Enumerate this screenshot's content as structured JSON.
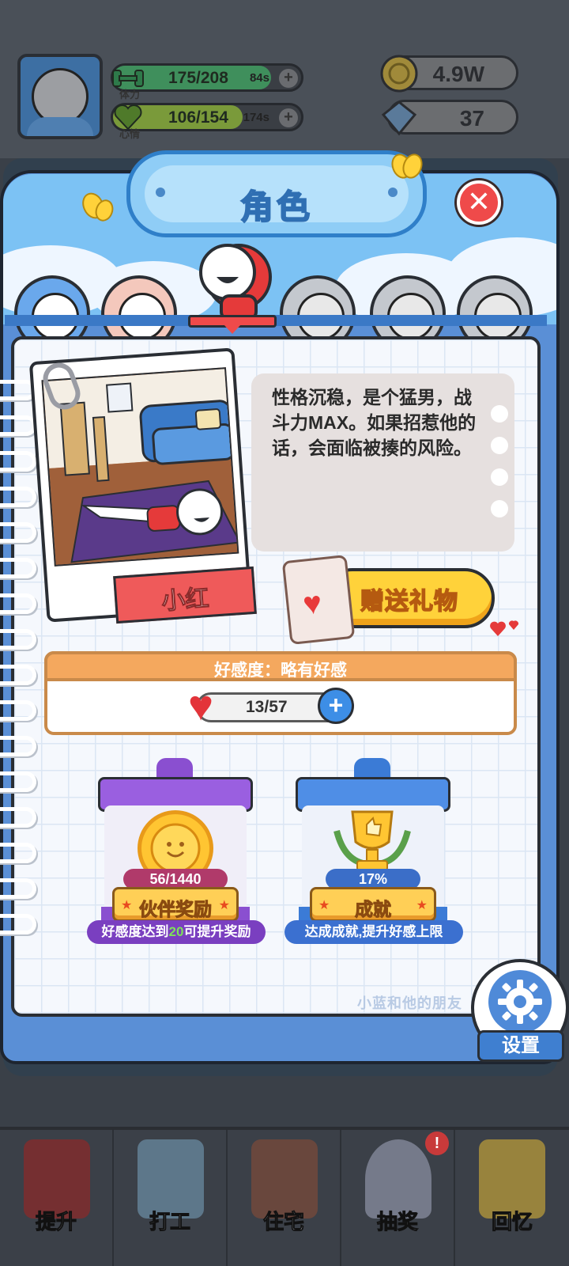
{
  "hud": {
    "stamina": {
      "label": "体力",
      "value": "175/208",
      "timer": "84s",
      "fill": 0.84
    },
    "mood": {
      "label": "心情",
      "value": "106/154",
      "timer": "174s",
      "fill": 0.69
    },
    "coins": "4.9W",
    "gems": "37"
  },
  "panel": {
    "title": "角色",
    "close": "✕"
  },
  "character": {
    "name": "小红",
    "description": "性格沉稳，是个猛男，战斗力MAX。如果招惹他的话，会面临被揍的风险。",
    "gift_button": "赠送礼物"
  },
  "affection": {
    "title": "好感度：略有好感",
    "value": "13/57",
    "plus": "+"
  },
  "cards": {
    "partner": {
      "count": "56/1440",
      "button": "伙伴奖励",
      "caption_pre": "好感度达到",
      "caption_num": "20",
      "caption_post": "可提升奖励"
    },
    "achievement": {
      "percent": "17%",
      "button": "成就",
      "caption": "达成成就,提升好感上限"
    }
  },
  "settings_label": "设置",
  "watermark": "小蓝和他的朋友",
  "bottom_nav": [
    {
      "label": "提升"
    },
    {
      "label": "打工"
    },
    {
      "label": "住宅"
    },
    {
      "label": "抽奖"
    },
    {
      "label": "回忆"
    }
  ],
  "badge": "!",
  "colors": {
    "accent_red": "#ef4a4a",
    "panel_blue": "#5a8fd6",
    "gift_yellow": "#ffd23a",
    "affection_orange": "#f4a85e",
    "partner_purple": "#8a4fd0",
    "achievement_blue": "#3b7bd6"
  }
}
